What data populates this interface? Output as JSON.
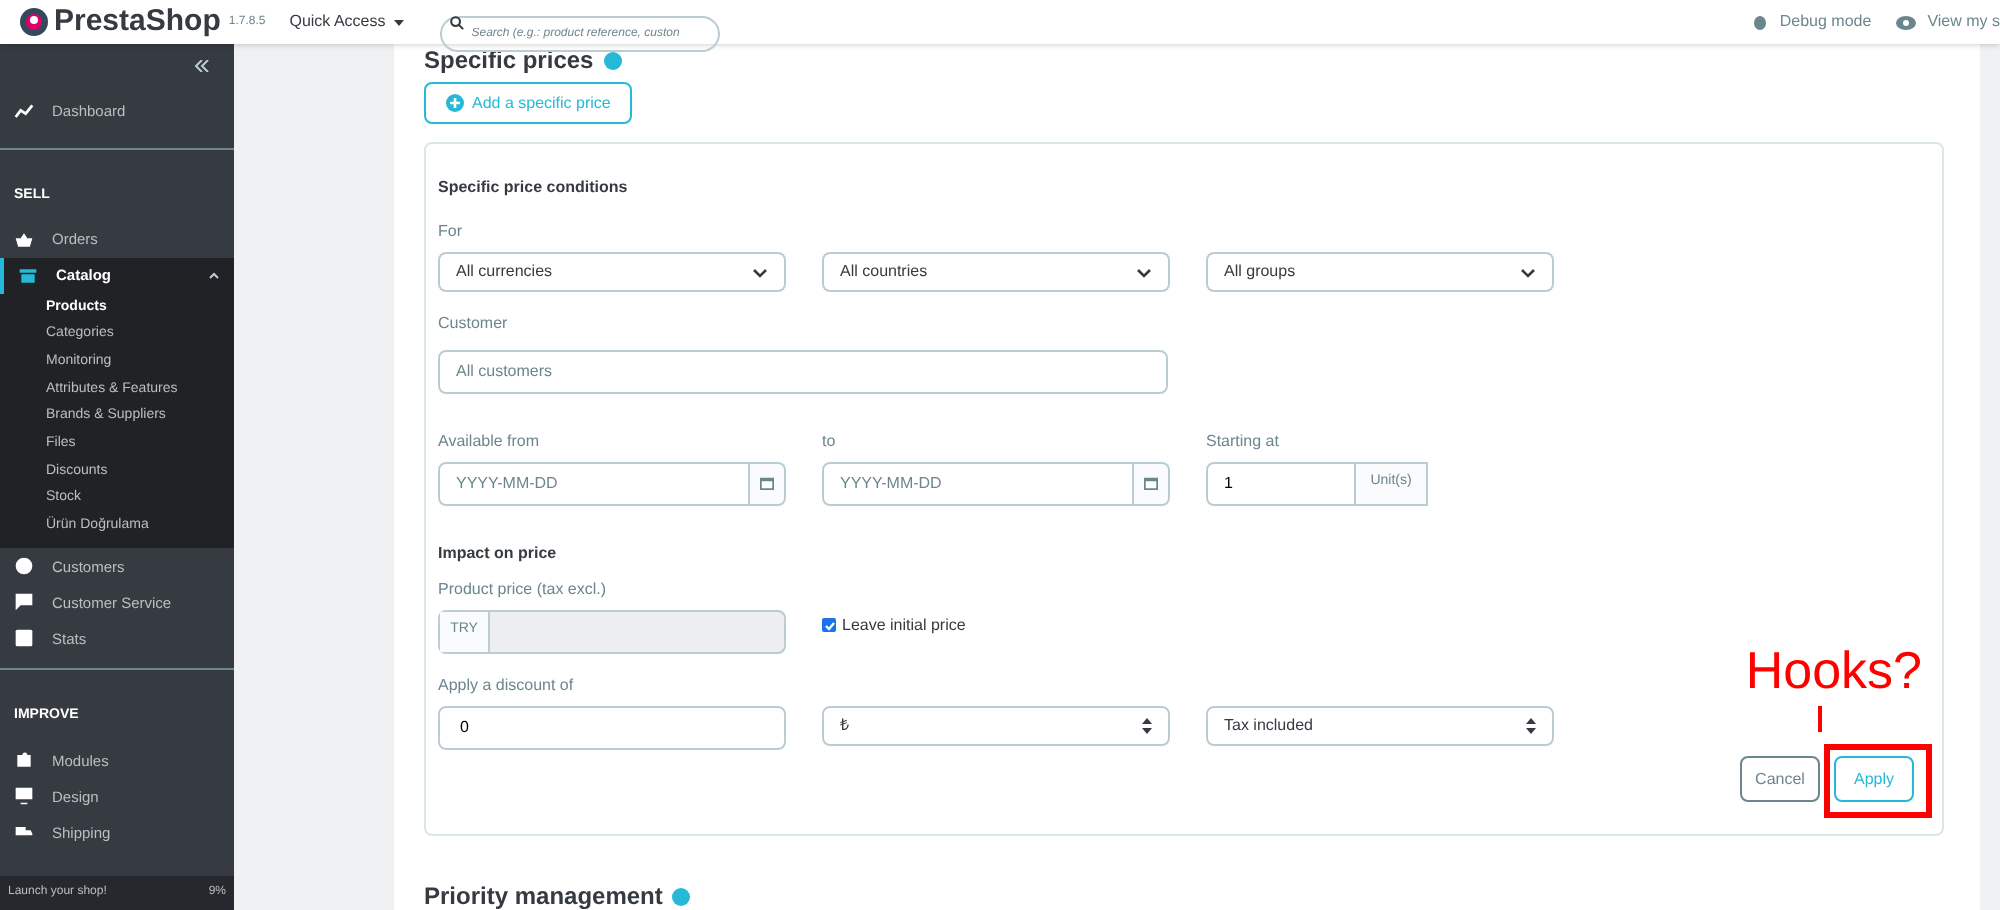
{
  "header": {
    "logo": "PrestaShop",
    "version": "1.7.8.5",
    "quick_access": "Quick Access",
    "search": {
      "placeholder": "Search (e.g.: product reference, custon"
    },
    "debug": "Debug mode",
    "view_shop": "View my s"
  },
  "sidebar": {
    "items": [
      {
        "kind": "item",
        "label": "Dashboard",
        "expanded": false
      },
      {
        "kind": "section",
        "label": "SELL"
      },
      {
        "kind": "item",
        "label": "Orders",
        "expanded": false
      },
      {
        "kind": "item",
        "label": "Catalog",
        "expanded": true,
        "children": [
          {
            "label": "Products",
            "selected": true
          },
          {
            "label": "Categories",
            "selected": false
          },
          {
            "label": "Monitoring",
            "selected": false
          },
          {
            "label": "Attributes & Features",
            "selected": false
          },
          {
            "label": "Brands & Suppliers",
            "selected": false
          },
          {
            "label": "Files",
            "selected": false
          },
          {
            "label": "Discounts",
            "selected": false
          },
          {
            "label": "Stock",
            "selected": false
          },
          {
            "label": "Ürün Doğrulama",
            "selected": false
          }
        ]
      },
      {
        "kind": "item",
        "label": "Customers",
        "expanded": false
      },
      {
        "kind": "item",
        "label": "Customer Service",
        "expanded": false
      },
      {
        "kind": "item",
        "label": "Stats",
        "expanded": false
      },
      {
        "kind": "section",
        "label": "IMPROVE"
      },
      {
        "kind": "item",
        "label": "Modules",
        "expanded": false
      },
      {
        "kind": "item",
        "label": "Design",
        "expanded": false
      },
      {
        "kind": "item",
        "label": "Shipping",
        "expanded": false
      }
    ],
    "launch": {
      "label": "Launch your shop!",
      "percent": "9%"
    }
  },
  "specific_prices": {
    "title": "Specific prices",
    "add_button": "Add a specific price",
    "conditions": {
      "title": "Specific price conditions",
      "for_label": "For",
      "selects": [
        "All currencies",
        "All countries",
        "All groups"
      ],
      "customer_label": "Customer",
      "customer": {
        "placeholder": "All customers"
      },
      "from_label": "Available from",
      "from": {
        "placeholder": "YYYY-MM-DD"
      },
      "to_label": "to",
      "to": {
        "placeholder": "YYYY-MM-DD"
      },
      "starting_label": "Starting at",
      "starting_value": "1",
      "unit": "Unit(s)"
    },
    "impact": {
      "title": "Impact on price",
      "price_label": "Product price (tax excl.)",
      "currency": "TRY",
      "leave_initial": {
        "label": "Leave initial price",
        "checked": true
      },
      "discount_label": "Apply a discount of",
      "discount_value": "0",
      "discount_type": "₺",
      "tax": "Tax included"
    },
    "buttons": {
      "cancel": "Cancel",
      "apply": "Apply"
    }
  },
  "annotation": "Hooks?",
  "priority": {
    "title": "Priority management"
  }
}
